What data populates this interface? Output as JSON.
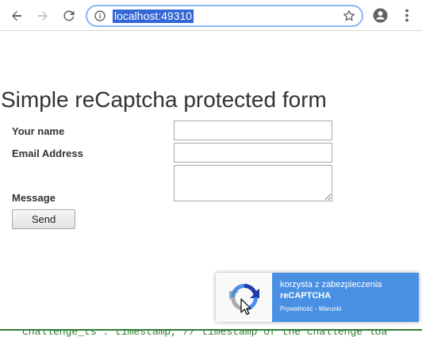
{
  "browser": {
    "url": "localhost:49310",
    "accent_color": "#8ab4f8",
    "selection_color": "#3367d6"
  },
  "page": {
    "title": "Simple reCaptcha protected form",
    "form": {
      "name_label": "Your name",
      "email_label": "Email Address",
      "message_label": "Message",
      "send_label": "Send",
      "name_value": "",
      "email_value": "",
      "message_value": ""
    }
  },
  "recaptcha": {
    "line1": "korzysta z zabezpieczenia",
    "line2": "reCAPTCHA",
    "privacy": "Prywatność",
    "separator": " - ",
    "terms": "Warunki",
    "badge_color": "#4a90e2"
  },
  "code_snippet": {
    "text": "challenge_ts\": timestamp,  // timestamp of the challenge loa"
  }
}
